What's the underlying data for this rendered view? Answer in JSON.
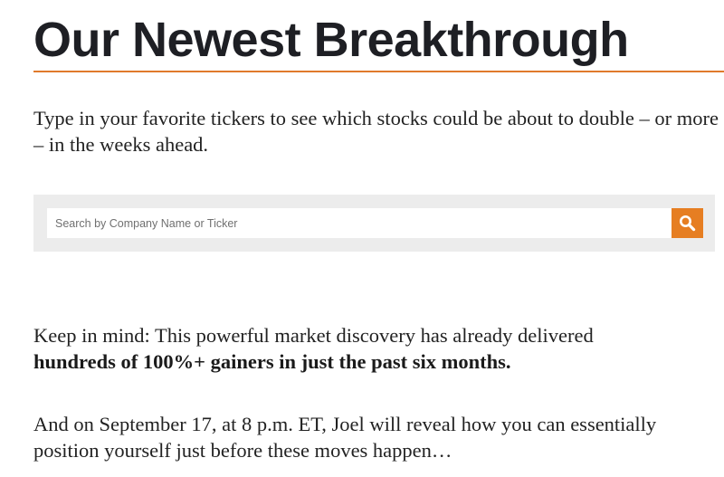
{
  "headline": "Our Newest Breakthrough",
  "intro": "Type in your favorite tickers to see which stocks could be about to double – or more – in the weeks ahead.",
  "search": {
    "placeholder": "Search by Company Name or Ticker",
    "button_icon": "search-icon"
  },
  "paragraphs": {
    "first_line": "Keep in mind: This powerful market discovery has already delivered",
    "first_bold": "hundreds of 100%+ gainers in just the past six months.",
    "second_line1": "And on September 17, at 8 p.m. ET, Joel will reveal how you can essentially",
    "second_line2": "position yourself just before these moves happen…"
  },
  "colors": {
    "accent": "#e67e22",
    "rule": "#e07a2b",
    "headline": "#1e1f24",
    "search_band": "#ececec",
    "body_text": "#222222"
  }
}
